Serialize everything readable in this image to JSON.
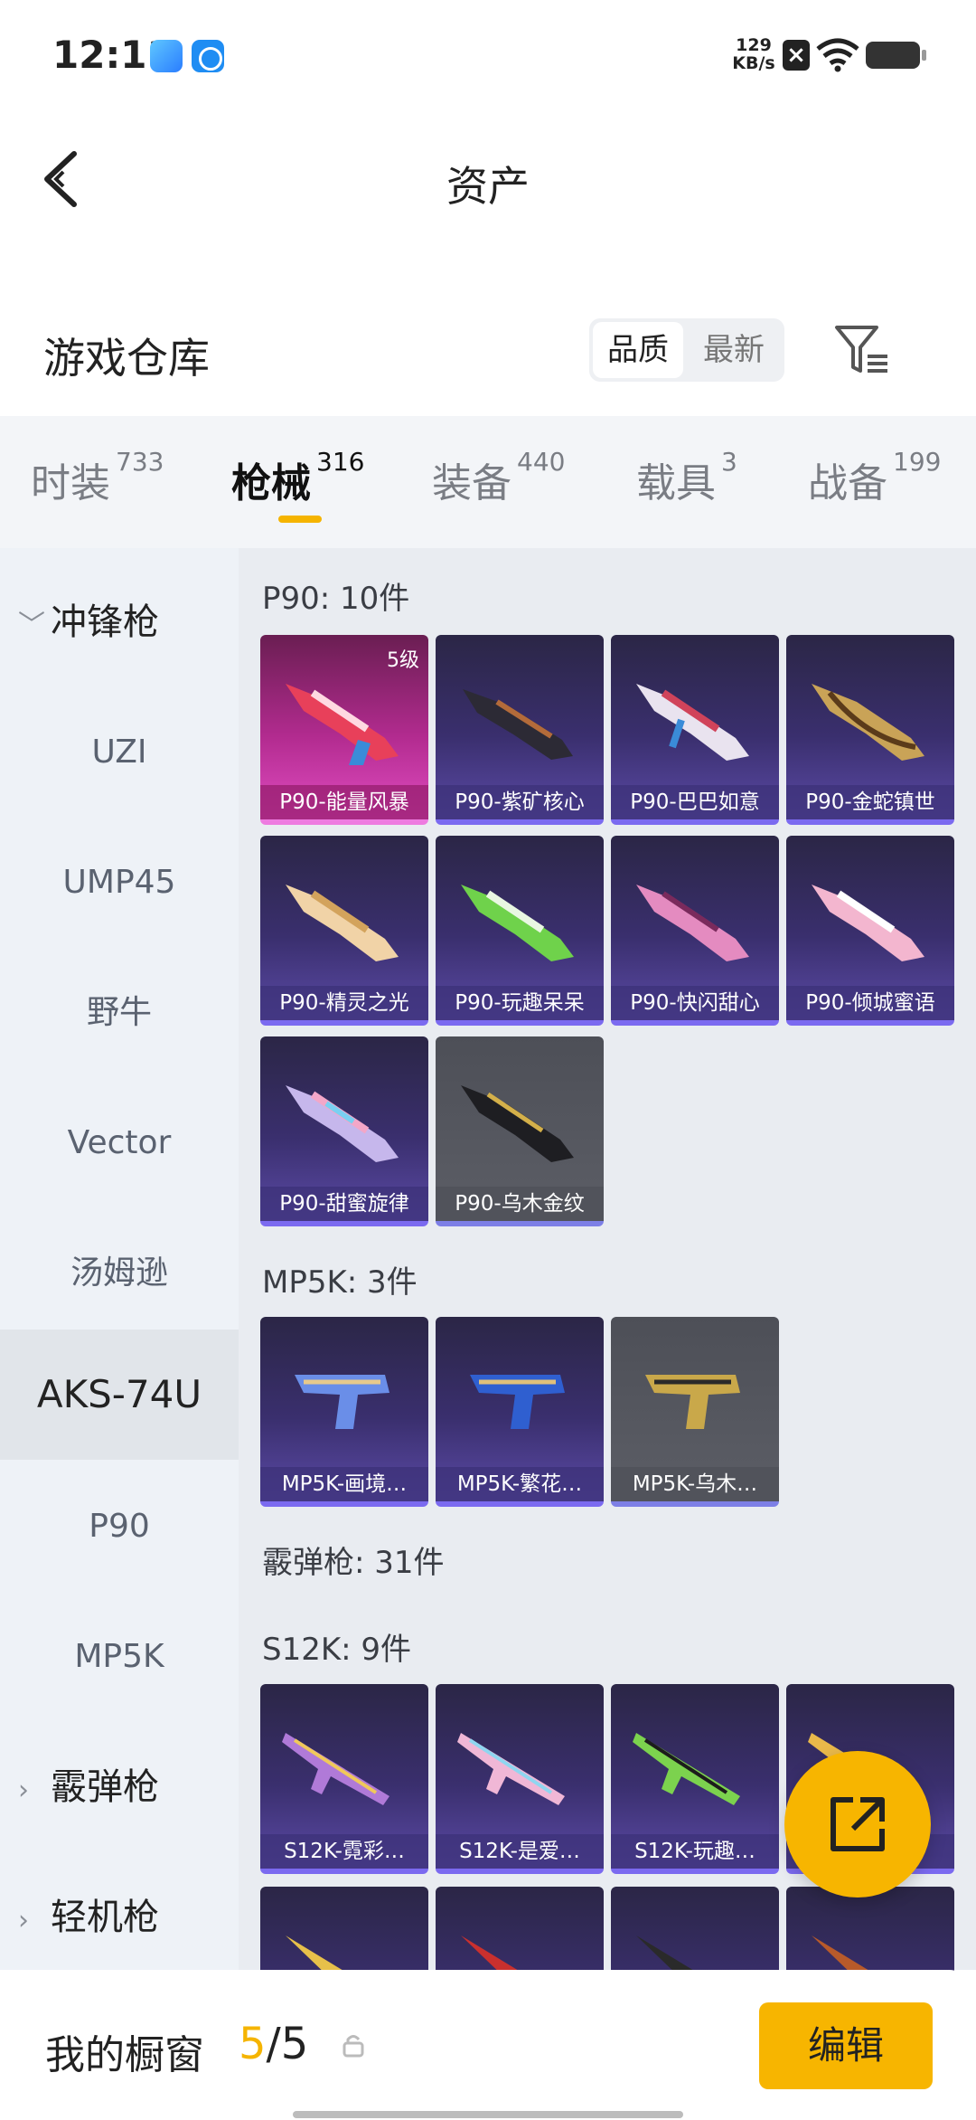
{
  "status_bar": {
    "time": "12:11",
    "net_speed_value": "129",
    "net_speed_unit": "KB/s"
  },
  "header": {
    "title": "资产"
  },
  "warehouse": {
    "title": "游戏仓库",
    "sort_quality": "品质",
    "sort_newest": "最新"
  },
  "tabs": [
    {
      "label": "时装",
      "count": "733"
    },
    {
      "label": "枪械",
      "count": "316"
    },
    {
      "label": "装备",
      "count": "440"
    },
    {
      "label": "载具",
      "count": "3"
    },
    {
      "label": "战备",
      "count": "199"
    }
  ],
  "sidebar": {
    "group_smg": "冲锋枪",
    "items": [
      "UZI",
      "UMP45",
      "野牛",
      "Vector",
      "汤姆逊",
      "AKS-74U",
      "P90",
      "MP5K"
    ],
    "group_shotgun": "霰弹枪",
    "group_lmg": "轻机枪"
  },
  "sections": {
    "p90": {
      "title": "P90: 10件",
      "items": [
        {
          "name": "P90-能量风暴",
          "level": "5级"
        },
        {
          "name": "P90-紫矿核心"
        },
        {
          "name": "P90-巴巴如意"
        },
        {
          "name": "P90-金蛇镇世"
        },
        {
          "name": "P90-精灵之光"
        },
        {
          "name": "P90-玩趣呆呆"
        },
        {
          "name": "P90-快闪甜心"
        },
        {
          "name": "P90-倾城蜜语"
        },
        {
          "name": "P90-甜蜜旋律"
        },
        {
          "name": "P90-乌木金纹"
        }
      ]
    },
    "mp5k": {
      "title": "MP5K: 3件",
      "items": [
        {
          "name": "MP5K-画境…"
        },
        {
          "name": "MP5K-繁花…"
        },
        {
          "name": "MP5K-乌木…"
        }
      ]
    },
    "shotgun": {
      "title": "霰弹枪: 31件"
    },
    "s12k": {
      "title": "S12K: 9件",
      "items": [
        {
          "name": "S12K-霓彩…"
        },
        {
          "name": "S12K-是爱…"
        },
        {
          "name": "S12K-玩趣…"
        },
        {
          "name": ""
        }
      ]
    }
  },
  "bottom_bar": {
    "showcase_label": "我的橱窗",
    "showcase_current": "5",
    "showcase_sep": "/",
    "showcase_total": "5",
    "edit_label": "编辑"
  },
  "icons": {
    "back": "chevron-left-icon",
    "filter": "filter-icon",
    "fab": "share-icon",
    "lock": "lock-icon"
  },
  "colors": {
    "accent": "#f7b500",
    "card_purple": "#3a2f6e",
    "card_pink": "#b22b8f",
    "card_grey": "#5c5e66"
  }
}
